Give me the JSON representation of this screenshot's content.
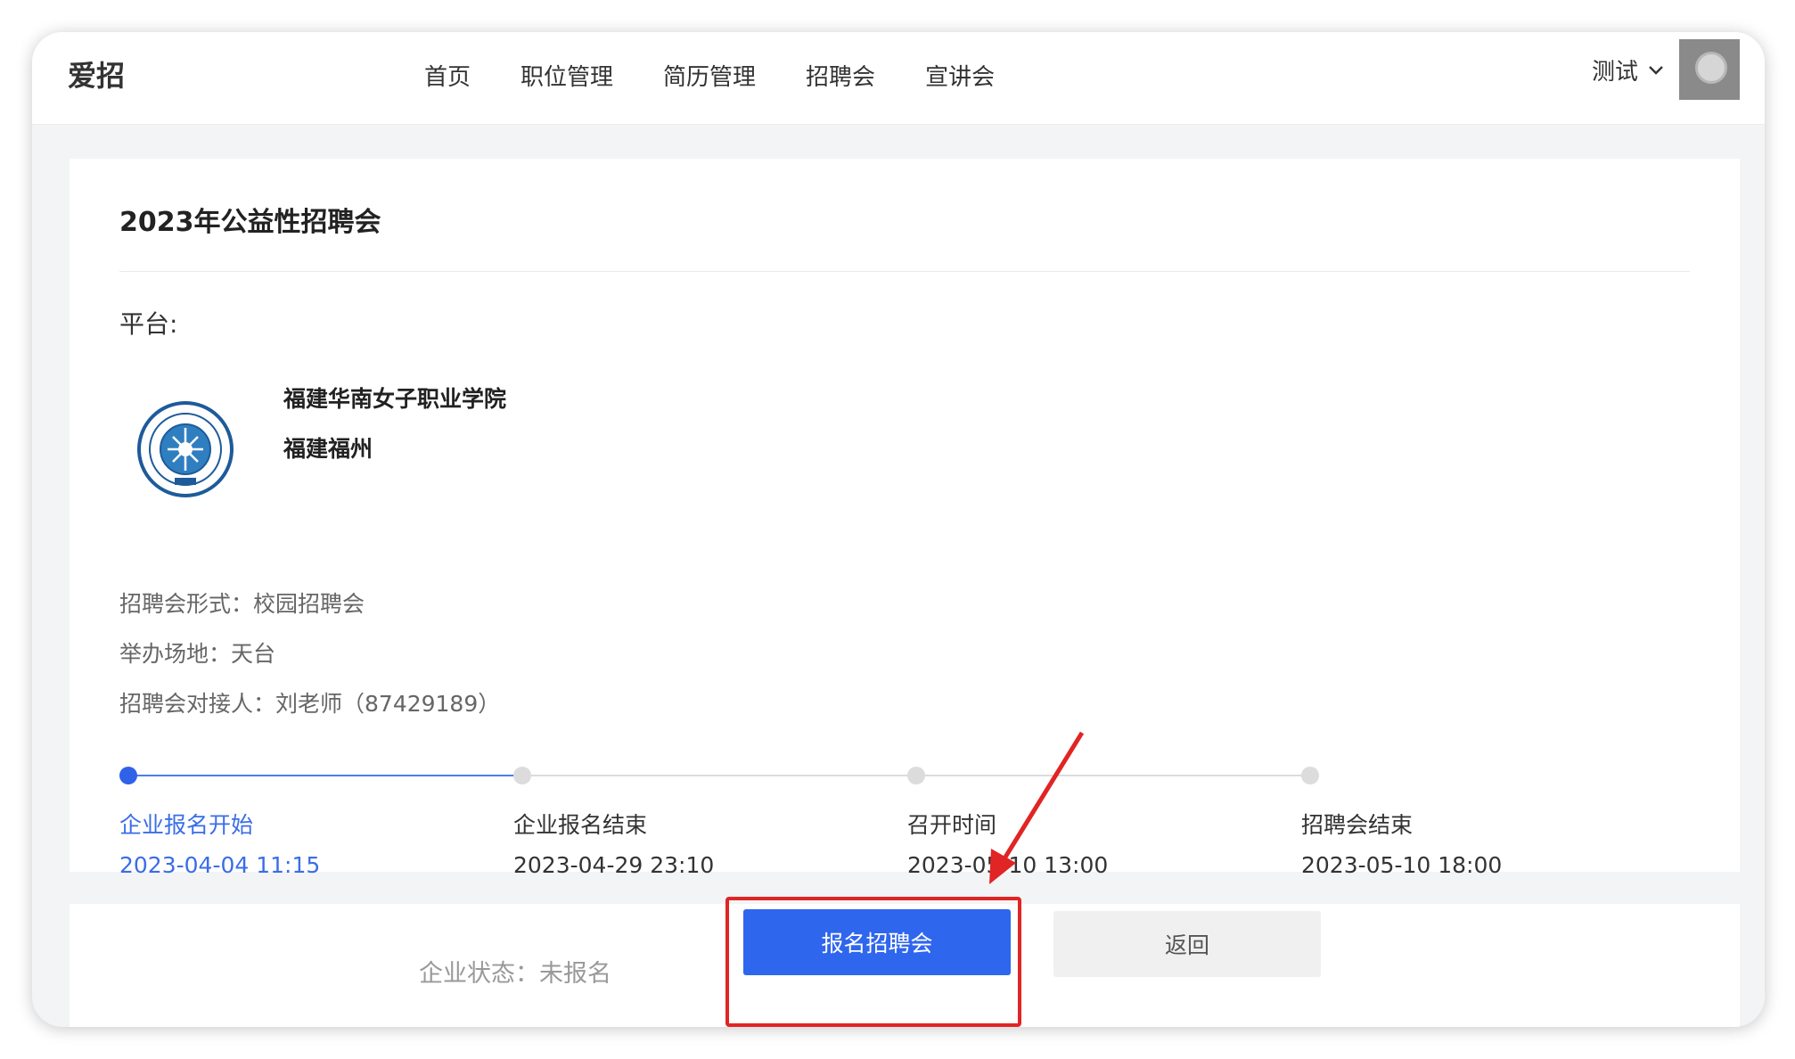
{
  "header": {
    "brand": "爱招",
    "nav": [
      "首页",
      "职位管理",
      "简历管理",
      "招聘会",
      "宣讲会"
    ],
    "user_name": "测试"
  },
  "event": {
    "title": "2023年公益性招聘会",
    "platform_label": "平台:",
    "org_name": "福建华南女子职业学院",
    "org_location": "福建福州",
    "format": "招聘会形式：校园招聘会",
    "venue": "举办场地：天台",
    "contact": "招聘会对接人：刘老师（87429189）"
  },
  "timeline": [
    {
      "title": "企业报名开始",
      "time": "2023-04-04 11:15"
    },
    {
      "title": "企业报名结束",
      "time": "2023-04-29 23:10"
    },
    {
      "title": "召开时间",
      "time": "2023-05-10 13:00"
    },
    {
      "title": "招聘会结束",
      "time": "2023-05-10 18:00"
    }
  ],
  "actions": {
    "status": "企业状态：未报名",
    "signup_label": "报名招聘会",
    "back_label": "返回"
  },
  "colors": {
    "primary": "#2f66ee",
    "annotation": "#e12424"
  }
}
